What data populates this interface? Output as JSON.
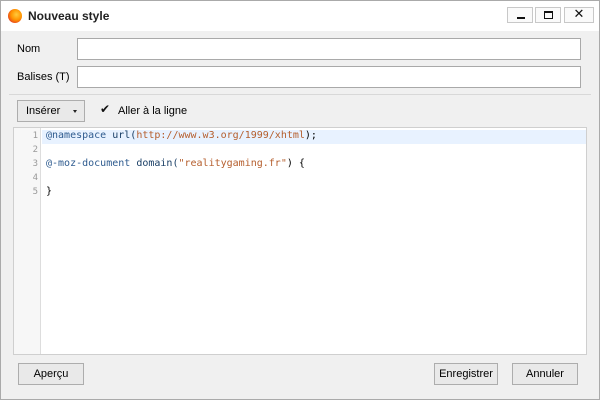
{
  "window": {
    "title": "Nouveau style",
    "controls": {
      "minimize": "",
      "maximize": "",
      "close": "✕"
    }
  },
  "form": {
    "nom": {
      "label": "Nom",
      "value": "",
      "placeholder": ""
    },
    "balises": {
      "label": "Balises (T)",
      "value": "",
      "placeholder": ""
    }
  },
  "toolbar": {
    "insert_label": "Insérer",
    "wrap_label": "Aller à la ligne",
    "wrap_checked": true
  },
  "editor": {
    "line_numbers": [
      "1",
      "2",
      "3",
      "4",
      "5"
    ],
    "lines": [
      {
        "kw": "@namespace",
        "fn": " url(",
        "str": "http://www.w3.org/1999/xhtml",
        "rest": ");"
      },
      {
        "text": ""
      },
      {
        "kw": "@-moz-document",
        "fn": " domain(",
        "str": "\"realitygaming.fr\"",
        "rest": ") {"
      },
      {
        "text": ""
      },
      {
        "text": "}"
      }
    ]
  },
  "footer": {
    "preview_label": "Aperçu",
    "save_label": "Enregistrer",
    "cancel_label": "Annuler"
  }
}
